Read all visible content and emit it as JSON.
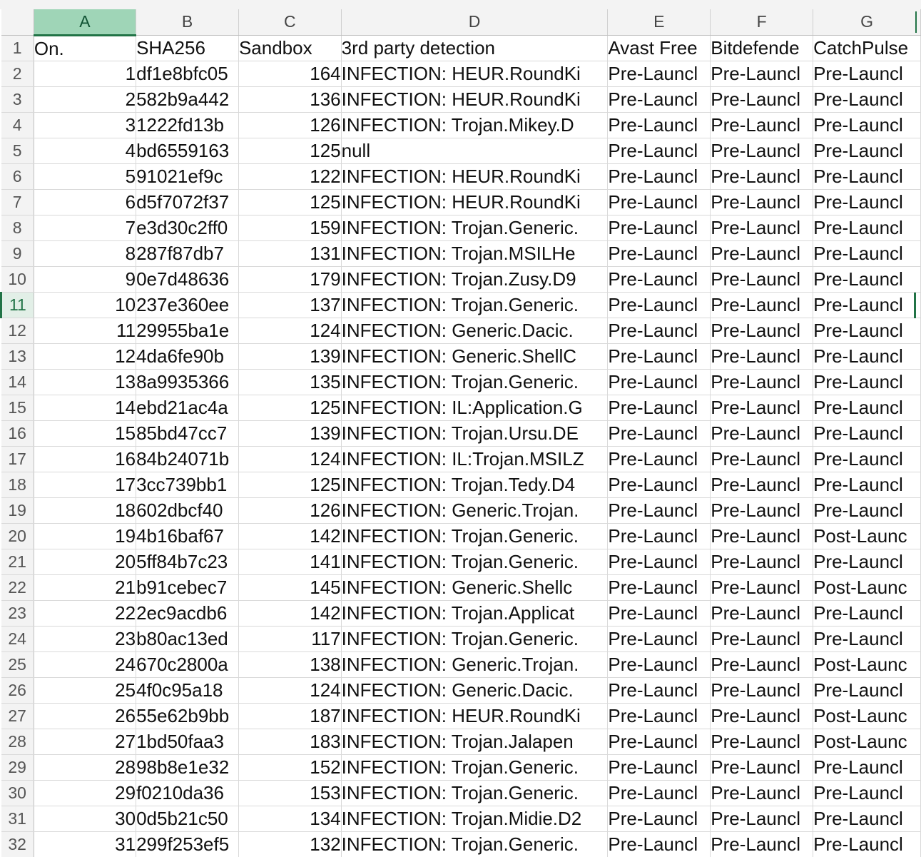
{
  "columns": [
    "A",
    "B",
    "C",
    "D",
    "E",
    "F",
    "G"
  ],
  "selected_column": "A",
  "selected_row": "11",
  "header_row": {
    "row_num": "1",
    "cells": [
      "On.",
      "SHA256",
      "Sandbox",
      "3rd party detection",
      "Avast Free",
      "Bitdefende",
      "CatchPulse"
    ]
  },
  "rows": [
    {
      "n": "2",
      "a": "1",
      "b": "df1e8bfc05",
      "c": "164",
      "d": "INFECTION: HEUR.RoundKi",
      "e": "Pre-Launcl",
      "f": "Pre-Launcl",
      "g": "Pre-Launcl"
    },
    {
      "n": "3",
      "a": "2",
      "b": "582b9a442",
      "c": "136",
      "d": "INFECTION: HEUR.RoundKi",
      "e": "Pre-Launcl",
      "f": "Pre-Launcl",
      "g": "Pre-Launcl"
    },
    {
      "n": "4",
      "a": "3",
      "b": "1222fd13b",
      "c": "126",
      "d": "INFECTION: Trojan.Mikey.D",
      "e": "Pre-Launcl",
      "f": "Pre-Launcl",
      "g": "Pre-Launcl"
    },
    {
      "n": "5",
      "a": "4",
      "b": "bd6559163",
      "c": "125",
      "d": "null",
      "e": "Pre-Launcl",
      "f": "Pre-Launcl",
      "g": "Pre-Launcl"
    },
    {
      "n": "6",
      "a": "5",
      "b": "91021ef9c",
      "c": "122",
      "d": "INFECTION: HEUR.RoundKi",
      "e": "Pre-Launcl",
      "f": "Pre-Launcl",
      "g": "Pre-Launcl"
    },
    {
      "n": "7",
      "a": "6",
      "b": "d5f7072f37",
      "c": "125",
      "d": "INFECTION: HEUR.RoundKi",
      "e": "Pre-Launcl",
      "f": "Pre-Launcl",
      "g": "Pre-Launcl"
    },
    {
      "n": "8",
      "a": "7",
      "b": "e3d30c2ff0",
      "c": "159",
      "d": "INFECTION: Trojan.Generic.",
      "e": "Pre-Launcl",
      "f": "Pre-Launcl",
      "g": "Pre-Launcl"
    },
    {
      "n": "9",
      "a": "8",
      "b": "287f87db7",
      "c": "131",
      "d": "INFECTION: Trojan.MSILHe",
      "e": "Pre-Launcl",
      "f": "Pre-Launcl",
      "g": "Pre-Launcl"
    },
    {
      "n": "10",
      "a": "9",
      "b": "0e7d48636",
      "c": "179",
      "d": "INFECTION: Trojan.Zusy.D9",
      "e": "Pre-Launcl",
      "f": "Pre-Launcl",
      "g": "Pre-Launcl"
    },
    {
      "n": "11",
      "a": "10",
      "b": "237e360ee",
      "c": "137",
      "d": "INFECTION: Trojan.Generic.",
      "e": "Pre-Launcl",
      "f": "Pre-Launcl",
      "g": "Pre-Launcl"
    },
    {
      "n": "12",
      "a": "11",
      "b": "29955ba1e",
      "c": "124",
      "d": "INFECTION: Generic.Dacic.",
      "e": "Pre-Launcl",
      "f": "Pre-Launcl",
      "g": "Pre-Launcl"
    },
    {
      "n": "13",
      "a": "12",
      "b": "4da6fe90b",
      "c": "139",
      "d": "INFECTION: Generic.ShellC",
      "e": "Pre-Launcl",
      "f": "Pre-Launcl",
      "g": "Pre-Launcl"
    },
    {
      "n": "14",
      "a": "13",
      "b": "8a9935366",
      "c": "135",
      "d": "INFECTION: Trojan.Generic.",
      "e": "Pre-Launcl",
      "f": "Pre-Launcl",
      "g": "Pre-Launcl"
    },
    {
      "n": "15",
      "a": "14",
      "b": "ebd21ac4a",
      "c": "125",
      "d": "INFECTION: IL:Application.G",
      "e": "Pre-Launcl",
      "f": "Pre-Launcl",
      "g": "Pre-Launcl"
    },
    {
      "n": "16",
      "a": "15",
      "b": "85bd47cc7",
      "c": "139",
      "d": "INFECTION: Trojan.Ursu.DE",
      "e": "Pre-Launcl",
      "f": "Pre-Launcl",
      "g": "Pre-Launcl"
    },
    {
      "n": "17",
      "a": "16",
      "b": "84b24071b",
      "c": "124",
      "d": "INFECTION: IL:Trojan.MSILZ",
      "e": "Pre-Launcl",
      "f": "Pre-Launcl",
      "g": "Pre-Launcl"
    },
    {
      "n": "18",
      "a": "17",
      "b": "3cc739bb1",
      "c": "125",
      "d": "INFECTION: Trojan.Tedy.D4",
      "e": "Pre-Launcl",
      "f": "Pre-Launcl",
      "g": "Pre-Launcl"
    },
    {
      "n": "19",
      "a": "18",
      "b": "602dbcf40",
      "c": "126",
      "d": "INFECTION: Generic.Trojan.",
      "e": "Pre-Launcl",
      "f": "Pre-Launcl",
      "g": "Pre-Launcl"
    },
    {
      "n": "20",
      "a": "19",
      "b": "4b16baf67",
      "c": "142",
      "d": "INFECTION: Trojan.Generic.",
      "e": "Pre-Launcl",
      "f": "Pre-Launcl",
      "g": "Post-Launc"
    },
    {
      "n": "21",
      "a": "20",
      "b": "5ff84b7c23",
      "c": "141",
      "d": "INFECTION: Trojan.Generic.",
      "e": "Pre-Launcl",
      "f": "Pre-Launcl",
      "g": "Pre-Launcl"
    },
    {
      "n": "22",
      "a": "21",
      "b": "b91cebec7",
      "c": "145",
      "d": "INFECTION: Generic.Shellc",
      "e": "Pre-Launcl",
      "f": "Pre-Launcl",
      "g": "Post-Launc"
    },
    {
      "n": "23",
      "a": "22",
      "b": "2ec9acdb6",
      "c": "142",
      "d": "INFECTION: Trojan.Applicat",
      "e": "Pre-Launcl",
      "f": "Pre-Launcl",
      "g": "Pre-Launcl"
    },
    {
      "n": "24",
      "a": "23",
      "b": "b80ac13ed",
      "c": "117",
      "d": "INFECTION: Trojan.Generic.",
      "e": "Pre-Launcl",
      "f": "Pre-Launcl",
      "g": "Pre-Launcl"
    },
    {
      "n": "25",
      "a": "24",
      "b": "670c2800a",
      "c": "138",
      "d": "INFECTION: Generic.Trojan.",
      "e": "Pre-Launcl",
      "f": "Pre-Launcl",
      "g": "Post-Launc"
    },
    {
      "n": "26",
      "a": "25",
      "b": "4f0c95a18",
      "c": "124",
      "d": "INFECTION: Generic.Dacic.",
      "e": "Pre-Launcl",
      "f": "Pre-Launcl",
      "g": "Pre-Launcl"
    },
    {
      "n": "27",
      "a": "26",
      "b": "55e62b9bb",
      "c": "187",
      "d": "INFECTION: HEUR.RoundKi",
      "e": "Pre-Launcl",
      "f": "Pre-Launcl",
      "g": "Post-Launc"
    },
    {
      "n": "28",
      "a": "27",
      "b": "1bd50faa3",
      "c": "183",
      "d": "INFECTION: Trojan.Jalapen",
      "e": "Pre-Launcl",
      "f": "Pre-Launcl",
      "g": "Post-Launc"
    },
    {
      "n": "29",
      "a": "28",
      "b": "98b8e1e32",
      "c": "152",
      "d": "INFECTION: Trojan.Generic.",
      "e": "Pre-Launcl",
      "f": "Pre-Launcl",
      "g": "Pre-Launcl"
    },
    {
      "n": "30",
      "a": "29",
      "b": "f0210da36",
      "c": "153",
      "d": "INFECTION: Trojan.Generic.",
      "e": "Pre-Launcl",
      "f": "Pre-Launcl",
      "g": "Pre-Launcl"
    },
    {
      "n": "31",
      "a": "30",
      "b": "0d5b21c50",
      "c": "134",
      "d": "INFECTION: Trojan.Midie.D2",
      "e": "Pre-Launcl",
      "f": "Pre-Launcl",
      "g": "Pre-Launcl"
    },
    {
      "n": "32",
      "a": "31",
      "b": "299f253ef5",
      "c": "132",
      "d": "INFECTION: Trojan.Generic.",
      "e": "Pre-Launcl",
      "f": "Pre-Launcl",
      "g": "Pre-Launcl"
    }
  ]
}
